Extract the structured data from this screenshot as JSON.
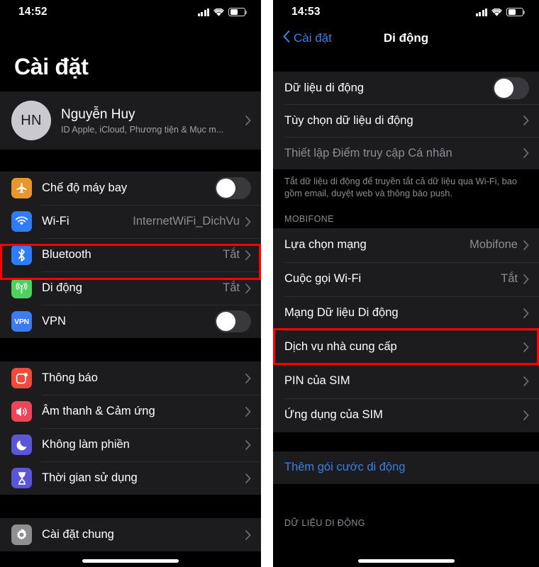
{
  "left_screen": {
    "status_bar": {
      "time": "14:52",
      "signal_icon": "signal-bars-icon",
      "wifi_icon": "wifi-icon",
      "battery_icon": "battery-icon",
      "battery_level_pct": 52
    },
    "title": "Cài đặt",
    "profile": {
      "initials": "HN",
      "name": "Nguyễn Huy",
      "subtitle": "ID Apple, iCloud, Phương tiện & Mục m...",
      "chevron": "chevron-right-icon"
    },
    "group1": [
      {
        "label": "Chế độ máy bay",
        "icon": "airplane-icon",
        "icon_color": "#e8962e",
        "control": "toggle",
        "toggle_on": false
      },
      {
        "label": "Wi-Fi",
        "icon": "wifi-icon",
        "icon_color": "#2f7cf6",
        "value": "InternetWiFi_DichVu",
        "control": "chevron"
      },
      {
        "label": "Bluetooth",
        "icon": "bluetooth-icon",
        "icon_color": "#2f7cf6",
        "value": "Tắt",
        "control": "chevron"
      },
      {
        "label": "Di động",
        "icon": "cellular-icon",
        "icon_color": "#4cd25f",
        "value": "Tắt",
        "control": "chevron",
        "highlighted": true
      },
      {
        "label": "VPN",
        "icon": "vpn-icon",
        "icon_color": "#3d7cf0",
        "control": "toggle",
        "toggle_on": false
      }
    ],
    "group2": [
      {
        "label": "Thông báo",
        "icon": "notifications-icon",
        "icon_color": "#ef4b3c",
        "control": "chevron"
      },
      {
        "label": "Âm thanh & Cảm ứng",
        "icon": "sound-icon",
        "icon_color": "#ee4559",
        "control": "chevron"
      },
      {
        "label": "Không làm phiền",
        "icon": "moon-icon",
        "icon_color": "#5a56d6",
        "control": "chevron"
      },
      {
        "label": "Thời gian sử dụng",
        "icon": "hourglass-icon",
        "icon_color": "#5a56d6",
        "control": "chevron"
      }
    ],
    "group3": [
      {
        "label": "Cài đặt chung",
        "icon": "gear-icon",
        "icon_color": "#8e8e93",
        "control": "chevron"
      }
    ]
  },
  "right_screen": {
    "status_bar": {
      "time": "14:53",
      "signal_icon": "signal-bars-icon",
      "wifi_icon": "wifi-icon",
      "battery_icon": "battery-icon",
      "battery_level_pct": 52
    },
    "nav": {
      "back_label": "Cài đặt",
      "back_icon": "chevron-left-icon",
      "title": "Di động"
    },
    "group1": [
      {
        "label": "Dữ liệu di động",
        "control": "toggle",
        "toggle_on": false
      },
      {
        "label": "Tùy chọn dữ liệu di động",
        "control": "chevron"
      },
      {
        "label": "Thiết lập Điểm truy cập Cá nhân",
        "control": "chevron",
        "dimmed": true
      }
    ],
    "footer1": "Tắt dữ liệu di động để truyền tắt cả dữ liệu qua Wi-Fi, bao gồm email, duyệt web và thông báo push.",
    "section2_header": "MOBIFONE",
    "group2": [
      {
        "label": "Lựa chọn mạng",
        "value": "Mobifone",
        "control": "chevron"
      },
      {
        "label": "Cuộc gọi Wi-Fi",
        "value": "Tắt",
        "control": "chevron"
      },
      {
        "label": "Mạng Dữ liệu Di động",
        "control": "chevron"
      },
      {
        "label": "Dịch vụ nhà cung cấp",
        "control": "chevron"
      },
      {
        "label": "PIN của SIM",
        "control": "chevron",
        "highlighted": true
      },
      {
        "label": "Ứng dụng của SIM",
        "control": "chevron"
      }
    ],
    "group3": [
      {
        "label": "Thêm gói cước di động",
        "control": "none",
        "link": true
      }
    ],
    "section4_header": "DỮ LIỆU DI ĐỘNG"
  }
}
